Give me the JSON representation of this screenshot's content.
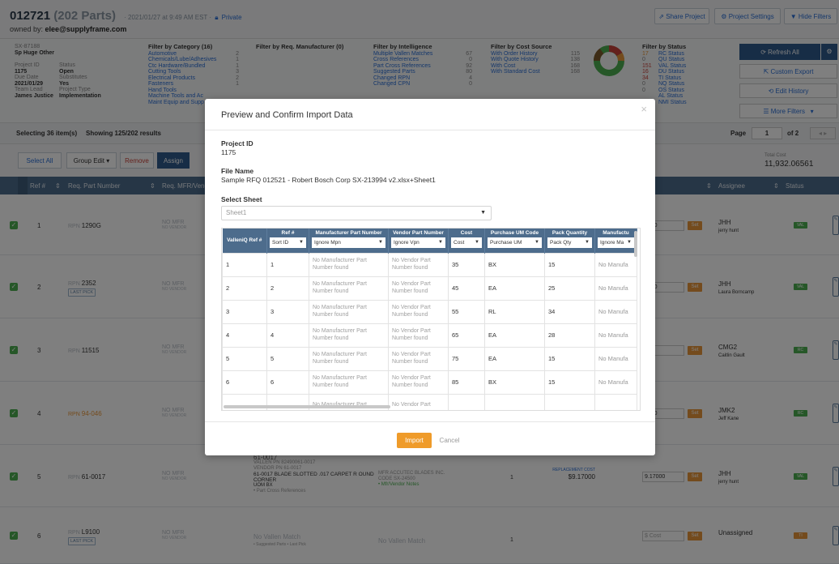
{
  "project": {
    "id_title": "012721",
    "parts": "(202 Parts)",
    "meta": "· 2021/01/27 at 9:49 AM EST ·",
    "privacy": "Private",
    "owner_label": "owned by:",
    "owner": "elee@supplyframe.com"
  },
  "top_buttons": {
    "share": "Share Project",
    "settings": "Project Settings",
    "hide_filters": "Hide Filters"
  },
  "info": {
    "code": "SX-87188",
    "name": "Sp Huge Other",
    "project_id_label": "Project ID",
    "project_id": "1175",
    "status_label": "Status",
    "status": "Open",
    "due_label": "Due Date",
    "due": "2021/01/29",
    "subs_label": "Substitutes",
    "subs": "Yes",
    "lead_label": "Team Lead",
    "lead": "James Justice",
    "type_label": "Project Type",
    "type": "Implementation"
  },
  "filter_category": {
    "title": "Filter by Category (16)",
    "items": [
      {
        "label": "Automotive",
        "count": "2"
      },
      {
        "label": "Chemicals/Lube/Adhesives",
        "count": "1"
      },
      {
        "label": "Ctc Hardware/Bundled",
        "count": "1"
      },
      {
        "label": "Cutting Tools",
        "count": "3"
      },
      {
        "label": "Electrical Products",
        "count": "2"
      },
      {
        "label": "Fasteners",
        "count": "1"
      },
      {
        "label": "Hand Tools",
        "count": ""
      },
      {
        "label": "Machine Tools and Ac",
        "count": ""
      },
      {
        "label": "Maint Equip and Supp",
        "count": ""
      }
    ]
  },
  "filter_mfr": {
    "title": "Filter by Req. Manufacturer (0)"
  },
  "filter_intel": {
    "title": "Filter by Intelligence",
    "items": [
      {
        "label": "Multiple Vallen Matches",
        "count": "67"
      },
      {
        "label": "Cross References",
        "count": "0"
      },
      {
        "label": "Part Cross References",
        "count": "92"
      },
      {
        "label": "Suggested Parts",
        "count": "80"
      },
      {
        "label": "Changed RPN",
        "count": "4"
      },
      {
        "label": "Changed CPN",
        "count": "0"
      }
    ]
  },
  "filter_cost": {
    "title": "Filter by Cost Source",
    "items": [
      {
        "label": "With Order History",
        "count": "115"
      },
      {
        "label": "With Quote History",
        "count": "138"
      },
      {
        "label": "With Cost",
        "count": "168"
      },
      {
        "label": "With Standard Cost",
        "count": "168"
      }
    ]
  },
  "filter_status": {
    "title": "Filter by Status",
    "items": [
      {
        "label": "RC Status",
        "count": "17"
      },
      {
        "label": "QU Status",
        "count": "0"
      },
      {
        "label": "VAL Status",
        "count": "151"
      },
      {
        "label": "DU Status",
        "count": "16"
      },
      {
        "label": "TI Status",
        "count": "34"
      },
      {
        "label": "NQ Status",
        "count": "0"
      },
      {
        "label": "OS Status",
        "count": "0"
      },
      {
        "label": "AL Status",
        "count": ""
      },
      {
        "label": "NMI Status",
        "count": ""
      }
    ]
  },
  "side_buttons": {
    "refresh": "Refresh All",
    "export": "Custom Export",
    "history": "Edit History",
    "more": "More Filters"
  },
  "selection": {
    "selecting": "Selecting 36 item(s)",
    "showing": "Showing 125/202 results",
    "page_label": "Page",
    "page": "1",
    "of": "of 2"
  },
  "toolbar": {
    "select_all": "Select All",
    "group_edit": "Group Edit",
    "remove": "Remove",
    "assign": "Assign",
    "total_cost_label": "Total Cost",
    "total_cost": "11,932.06561"
  },
  "grid_header": {
    "ref": "Ref #",
    "req_part": "Req. Part Number",
    "req_mfr": "Req. MFR/Vendor",
    "assignee": "Assignee",
    "status": "Status"
  },
  "grid_rows": [
    {
      "ref": "1",
      "part": "1290G",
      "mfr": "NO MFR",
      "vendor": "NO VENDOR",
      "tag": "",
      "cost": "3000",
      "assignee": "JHH",
      "assignee_name": "jerry hunt",
      "status": "VAL"
    },
    {
      "ref": "2",
      "part": "2352",
      "mfr": "NO MFR",
      "vendor": "NO VENDOR",
      "tag": "LAST PICK",
      "cost": "9000",
      "assignee": "JHH",
      "assignee_name": "Laura Borncamp",
      "status": "VAL"
    },
    {
      "ref": "3",
      "part": "11515",
      "mfr": "NO MFR",
      "vendor": "NO VENDOR",
      "tag": "",
      "cost": "000",
      "assignee": "CMG2",
      "assignee_name": "Caitlin Gault",
      "status": "RC"
    },
    {
      "ref": "4",
      "part": "94-046",
      "mfr": "NO MFR",
      "vendor": "NO VENDOR",
      "tag": "",
      "cost": "9400",
      "assignee": "JMK2",
      "assignee_name": "Jeff Kane",
      "status": "RC"
    },
    {
      "ref": "5",
      "part": "61-0017",
      "mfr": "NO MFR",
      "vendor": "NO VENDOR",
      "tag": "",
      "cost": "9.17000",
      "assignee": "JHH",
      "assignee_name": "jerry hunt",
      "status": "VAL"
    },
    {
      "ref": "6",
      "part": "L9100",
      "mfr": "NO MFR",
      "vendor": "NO VENDOR",
      "tag": "LAST PICK",
      "cost": "$ Cost",
      "assignee": "Unassigned",
      "assignee_name": "",
      "status": "TI"
    }
  ],
  "row5_detail": {
    "mfr_pn": "61-0017",
    "vallen_pn": "VALLEN PN 82490061-0017",
    "vendor_pn": "VENDOR PN 61-0017",
    "desc": "61-0017 BLADE SLOTTED .017 CARPET R OUND CORNER",
    "uom": "UOM BX",
    "note": "• Part Cross References",
    "mfr_label": "MFR ACCUTEC BLADES INC.",
    "code_label": "CODE SX-24500",
    "mfr_note": "• Mfr/Vendor Notes",
    "qty": "1",
    "repl_label": "REPLACEMENT COST",
    "repl_cost": "$9.17000"
  },
  "row6_detail": {
    "match": "No Vallen Match",
    "match_note": "• Suggested Parts  • Last Pick",
    "match2": "No Vallen Match",
    "qty": "1"
  },
  "set_label": "Set",
  "rpn_prefix": "RPN",
  "modal": {
    "title": "Preview and Confirm Import Data",
    "project_id_label": "Project ID",
    "project_id": "1175",
    "file_label": "File Name",
    "file": "Sample RFQ 012521 - Robert Bosch Corp SX-213994 v2.xlsx+Sheet1",
    "sheet_label": "Select Sheet",
    "sheet": "Sheet1",
    "import": "Import",
    "cancel": "Cancel",
    "columns": [
      {
        "label": "ValleniQ Ref #",
        "select": ""
      },
      {
        "label": "Ref #",
        "select": "Sort ID"
      },
      {
        "label": "Manufacturer Part Number",
        "select": "Ignore Mpn"
      },
      {
        "label": "Vendor Part Number",
        "select": "Ignore Vpn"
      },
      {
        "label": "Cost",
        "select": "Cost"
      },
      {
        "label": "Purchase UM Code",
        "select": "Purchase UM"
      },
      {
        "label": "Pack Quantity",
        "select": "Pack Qty"
      },
      {
        "label": "Manufactu",
        "select": "Ignore Ma"
      }
    ],
    "rows": [
      [
        "1",
        "1",
        "No Manufacturer Part Number found",
        "No Vendor Part Number found",
        "35",
        "BX",
        "15",
        "No Manufa"
      ],
      [
        "2",
        "2",
        "No Manufacturer Part Number found",
        "No Vendor Part Number found",
        "45",
        "EA",
        "25",
        "No Manufa"
      ],
      [
        "3",
        "3",
        "No Manufacturer Part Number found",
        "No Vendor Part Number found",
        "55",
        "RL",
        "34",
        "No Manufa"
      ],
      [
        "4",
        "4",
        "No Manufacturer Part Number found",
        "No Vendor Part Number found",
        "65",
        "EA",
        "28",
        "No Manufa"
      ],
      [
        "5",
        "5",
        "No Manufacturer Part Number found",
        "No Vendor Part Number found",
        "75",
        "EA",
        "15",
        "No Manufa"
      ],
      [
        "6",
        "6",
        "No Manufacturer Part Number found",
        "No Vendor Part Number found",
        "85",
        "BX",
        "15",
        "No Manufa"
      ],
      [
        "",
        "",
        "No Manufacturer Part",
        "No Vendor Part",
        "",
        "",
        "",
        ""
      ]
    ]
  }
}
